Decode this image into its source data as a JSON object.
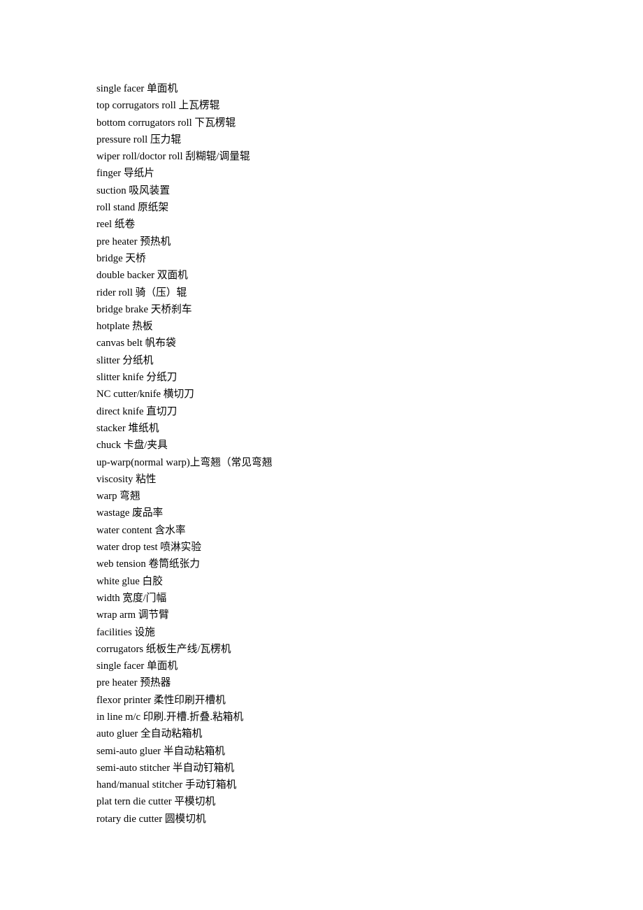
{
  "document": {
    "kind": "glossary-term-list",
    "language_pair": "English-Chinese",
    "entries": [
      "single facer 单面机",
      "top corrugators roll 上瓦楞辊",
      "bottom corrugators roll 下瓦楞辊",
      "pressure roll 压力辊",
      "wiper roll/doctor roll 刮糊辊/调量辊",
      "finger 导纸片",
      "suction 吸风装置",
      "roll stand 原纸架",
      "reel 纸卷",
      "pre heater 预热机",
      "bridge 天桥",
      "double backer 双面机",
      "rider roll 骑（压）辊",
      "bridge brake 天桥刹车",
      "hotplate 热板",
      "canvas belt 帆布袋",
      "slitter 分纸机",
      "slitter knife 分纸刀",
      "NC cutter/knife 横切刀",
      "direct knife 直切刀",
      "stacker 堆纸机",
      "chuck 卡盘/夹具",
      "up-warp(normal warp)上弯翘（常见弯翘",
      "viscosity 粘性",
      "warp 弯翘",
      "wastage 废品率",
      "water content 含水率",
      "water drop test 喷淋实验",
      "web tension 卷筒纸张力",
      "white glue 白胶",
      "width 宽度/门幅",
      "wrap arm 调节臂",
      "facilities 设施",
      "corrugators 纸板生产线/瓦楞机",
      "single facer 单面机",
      "pre heater 预热器",
      "flexor printer 柔性印刷开槽机",
      "in line m/c 印刷.开槽.折叠.粘箱机",
      "auto gluer 全自动粘箱机",
      "semi-auto gluer 半自动粘箱机",
      "semi-auto stitcher 半自动钉箱机",
      "hand/manual stitcher 手动钉箱机",
      "plat tern die cutter 平模切机",
      "rotary die cutter 圆模切机"
    ]
  }
}
